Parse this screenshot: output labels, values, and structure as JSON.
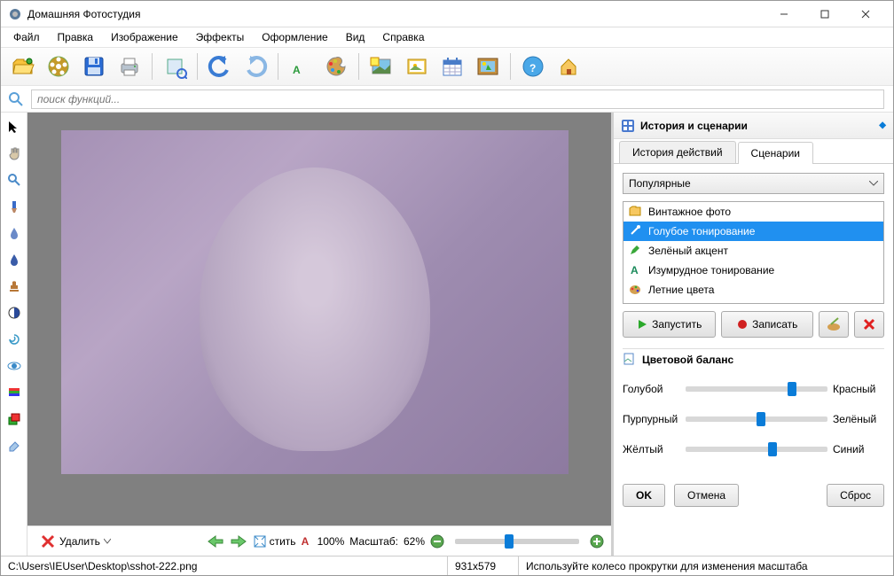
{
  "window": {
    "title": "Домашняя Фотостудия"
  },
  "menu": {
    "file": "Файл",
    "edit": "Правка",
    "image": "Изображение",
    "effects": "Эффекты",
    "design": "Оформление",
    "view": "Вид",
    "help": "Справка"
  },
  "search": {
    "placeholder": "поиск функций..."
  },
  "panel": {
    "title": "История и сценарии",
    "tab_history": "История действий",
    "tab_scenarios": "Сценарии",
    "category": "Популярные",
    "scenarios": {
      "vintage": "Винтажное фото",
      "blue": "Голубое тонирование",
      "green": "Зелёный акцент",
      "emerald": "Изумрудное тонирование",
      "summer": "Летние цвета"
    },
    "run": "Запустить",
    "record": "Записать"
  },
  "color_balance": {
    "title": "Цветовой баланс",
    "cyan": "Голубой",
    "red": "Красный",
    "magenta": "Пурпурный",
    "green_l": "Зелёный",
    "yellow": "Жёлтый",
    "blue_l": "Синий",
    "ok": "OK",
    "cancel": "Отмена",
    "reset": "Сброс",
    "values": {
      "cyan_red": 72,
      "magenta_green": 50,
      "yellow_blue": 58
    }
  },
  "bottom": {
    "delete": "Удалить",
    "fit": "стить",
    "zoom_label_a": "100%",
    "zoom_label_b": "Масштаб:",
    "zoom_value": "62%"
  },
  "status": {
    "path": "C:\\Users\\IEUser\\Desktop\\sshot-222.png",
    "dims": "931x579",
    "hint": "Используйте колесо прокрутки для изменения масштаба"
  }
}
